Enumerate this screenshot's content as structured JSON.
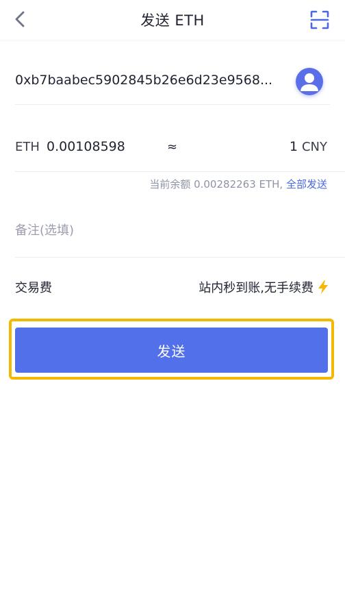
{
  "header": {
    "title": "发送 ETH",
    "back_icon": "chevron-left-icon",
    "scan_icon": "scan-icon"
  },
  "recipient": {
    "address": "0xb7baabec5902845b26e6d23e9568...",
    "avatar_icon": "user-avatar-icon"
  },
  "amount": {
    "unit_label": "ETH",
    "value": "0.00108598",
    "approx_symbol": "≈",
    "fiat_value": "1",
    "fiat_unit": "CNY"
  },
  "balance": {
    "text": "当前余额 0.00282263 ETH,",
    "send_all_label": "全部发送"
  },
  "memo": {
    "placeholder": "备注(选填)",
    "value": ""
  },
  "fee": {
    "label": "交易费",
    "value": "站内秒到账,无手续费",
    "icon": "lightning-icon"
  },
  "actions": {
    "send_label": "发送"
  },
  "colors": {
    "accent": "#5270e9",
    "link": "#4a68e0",
    "highlight": "#f5b800",
    "bolt": "#f5b800"
  }
}
